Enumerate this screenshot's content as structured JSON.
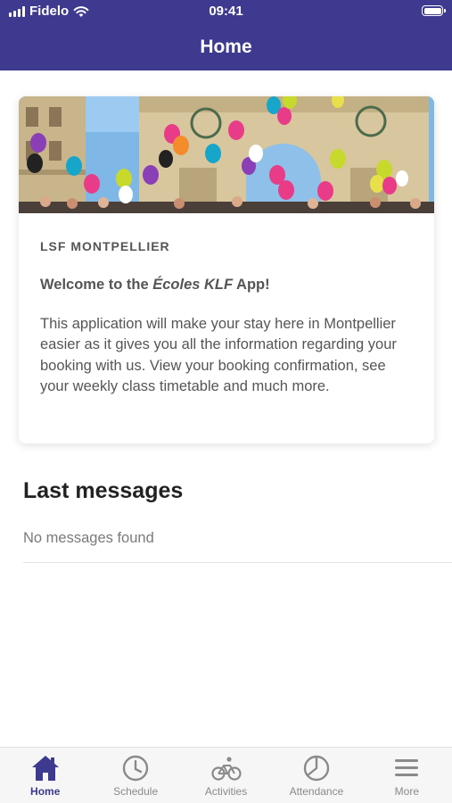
{
  "status": {
    "carrier": "Fidelo",
    "time": "09:41"
  },
  "header": {
    "title": "Home"
  },
  "card": {
    "school": "LSF MONTPELLIER",
    "welcome_pre": "Welcome to the ",
    "welcome_app": "Écoles KLF",
    "welcome_post": " App!",
    "description": "This application will make your stay here in Montpellier easier as it gives you all the information regarding your booking with us. View your booking confirmation, see your weekly class timetable and much more."
  },
  "messages": {
    "title": "Last messages",
    "empty": "No messages found"
  },
  "tabs": [
    {
      "label": "Home",
      "icon": "home-icon"
    },
    {
      "label": "Schedule",
      "icon": "clock-icon"
    },
    {
      "label": "Activities",
      "icon": "bicycle-icon"
    },
    {
      "label": "Attendance",
      "icon": "pie-chart-icon"
    },
    {
      "label": "More",
      "icon": "menu-icon"
    }
  ],
  "colors": {
    "brand": "#3d3a8f",
    "tab_inactive": "#8a8a8a"
  }
}
